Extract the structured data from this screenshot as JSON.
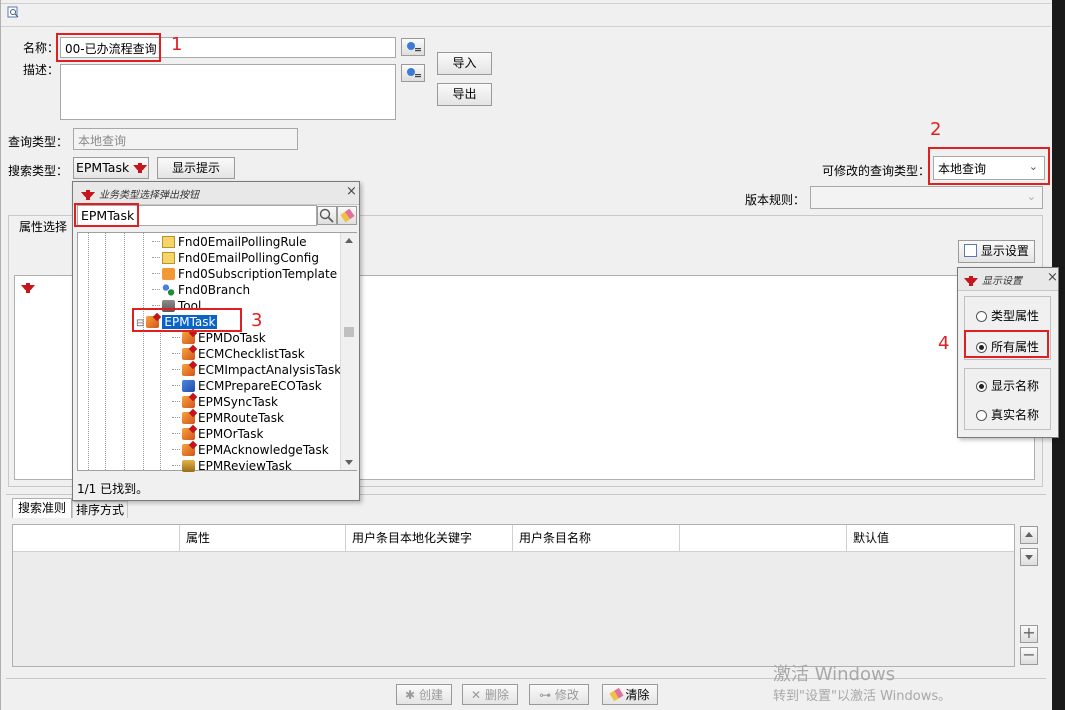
{
  "header": {
    "preview_icon": "preview-icon"
  },
  "form": {
    "name_label": "名称：",
    "name_value": "00-已办流程查询",
    "desc_label": "描述：",
    "import_label": "导入",
    "export_label": "导出",
    "query_type_label": "查询类型：",
    "query_type_value": "本地查询",
    "search_type_label": "搜索类型：",
    "search_type_value": "EPMTask",
    "show_hint_label": "显示提示",
    "modifiable_type_label": "可修改的查询类型：",
    "modifiable_type_value": "本地查询",
    "version_rule_label": "版本规则：",
    "version_rule_value": ""
  },
  "attr_section": {
    "title": "属性选择",
    "display_settings_label": "显示设置"
  },
  "popup": {
    "title": "业务类型选择弹出按钮",
    "search_value": "EPMTask",
    "status": "1/1 已找到。",
    "tree": [
      {
        "label": "Fnd0EmailPollingRule",
        "icon": "mail-rule-icon"
      },
      {
        "label": "Fnd0EmailPollingConfig",
        "icon": "mail-config-icon"
      },
      {
        "label": "Fnd0SubscriptionTemplate",
        "icon": "rss-icon"
      },
      {
        "label": "Fnd0Branch",
        "icon": "branch-icon"
      },
      {
        "label": "Tool",
        "icon": "tool-icon"
      },
      {
        "label": "EPMTask",
        "icon": "task-icon"
      },
      {
        "label": "EPMDoTask",
        "icon": "task-icon"
      },
      {
        "label": "ECMChecklistTask",
        "icon": "task-icon"
      },
      {
        "label": "ECMImpactAnalysisTask",
        "icon": "task-icon"
      },
      {
        "label": "ECMPrepareECOTask",
        "icon": "blue-task-icon"
      },
      {
        "label": "EPMSyncTask",
        "icon": "task-icon"
      },
      {
        "label": "EPMRouteTask",
        "icon": "task-icon"
      },
      {
        "label": "EPMOrTask",
        "icon": "task-icon"
      },
      {
        "label": "EPMAcknowledgeTask",
        "icon": "task-icon"
      },
      {
        "label": "EPMReviewTask",
        "icon": "review-task-icon"
      }
    ]
  },
  "display_popup": {
    "title": "显示设置",
    "type_attr": "类型属性",
    "all_attr": "所有属性",
    "show_name": "显示名称",
    "real_name": "真实名称",
    "all_attr_selected": true,
    "show_name_selected": true
  },
  "annotations": [
    "1",
    "2",
    "3",
    "4"
  ],
  "bottom_tabs": [
    "搜索准则",
    "排序方式"
  ],
  "table": {
    "columns": [
      "",
      "属性",
      "用户条目本地化关键字",
      "用户条目名称",
      "",
      "默认值"
    ]
  },
  "actions": {
    "create": "创建",
    "delete": "删除",
    "modify": "修改",
    "clear": "清除"
  },
  "watermark": {
    "line1": "激活 Windows",
    "line2": "转到\"设置\"以激活 Windows。"
  },
  "colors": {
    "annotation_red": "#e02020",
    "selection_blue": "#0a64c8"
  }
}
